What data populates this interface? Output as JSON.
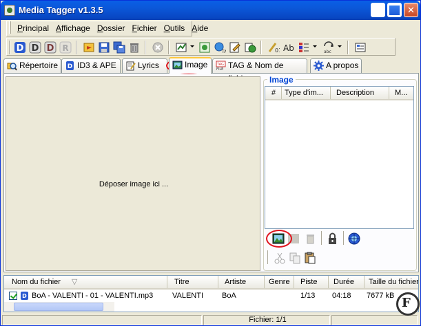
{
  "window": {
    "title": "Media Tagger v1.3.5"
  },
  "menu": [
    "Principal",
    "Affichage",
    "Dossier",
    "Fichier",
    "Outils",
    "Aide"
  ],
  "tabs": [
    {
      "label": "Répertoire",
      "icon": "magnifier-folder-icon"
    },
    {
      "label": "ID3 & APE",
      "icon": "id3-badge-icon"
    },
    {
      "label": "Lyrics",
      "icon": "notepad-icon"
    },
    {
      "label": "Image",
      "icon": "picture-icon",
      "active": true
    },
    {
      "label": "TAG & Nom de fichier",
      "icon": "tag-file-icon"
    },
    {
      "label": "A propos",
      "icon": "gear-icon"
    }
  ],
  "drop_zone": {
    "text": "Déposer image ici ..."
  },
  "image_group": {
    "title": "Image",
    "columns": [
      "#",
      "Type d'im...",
      "Description",
      "M..."
    ]
  },
  "file_list": {
    "columns": [
      "Nom du fichier",
      "Titre",
      "Artiste",
      "Genre",
      "Piste",
      "Durée",
      "Taille du fichier"
    ],
    "rows": [
      {
        "checked": true,
        "filename": "BoA - VALENTI - 01 - VALENTI.mp3",
        "title": "VALENTI",
        "artist": "BoA",
        "genre": "",
        "track": "1/13",
        "duration": "04:18",
        "size": "7677 kB"
      }
    ]
  },
  "status": {
    "files": "Fichier: 1/1"
  },
  "colors": {
    "titlebar": "#0a5fe6",
    "highlight_circle": "#e0141e",
    "group_title": "#0046d5"
  }
}
